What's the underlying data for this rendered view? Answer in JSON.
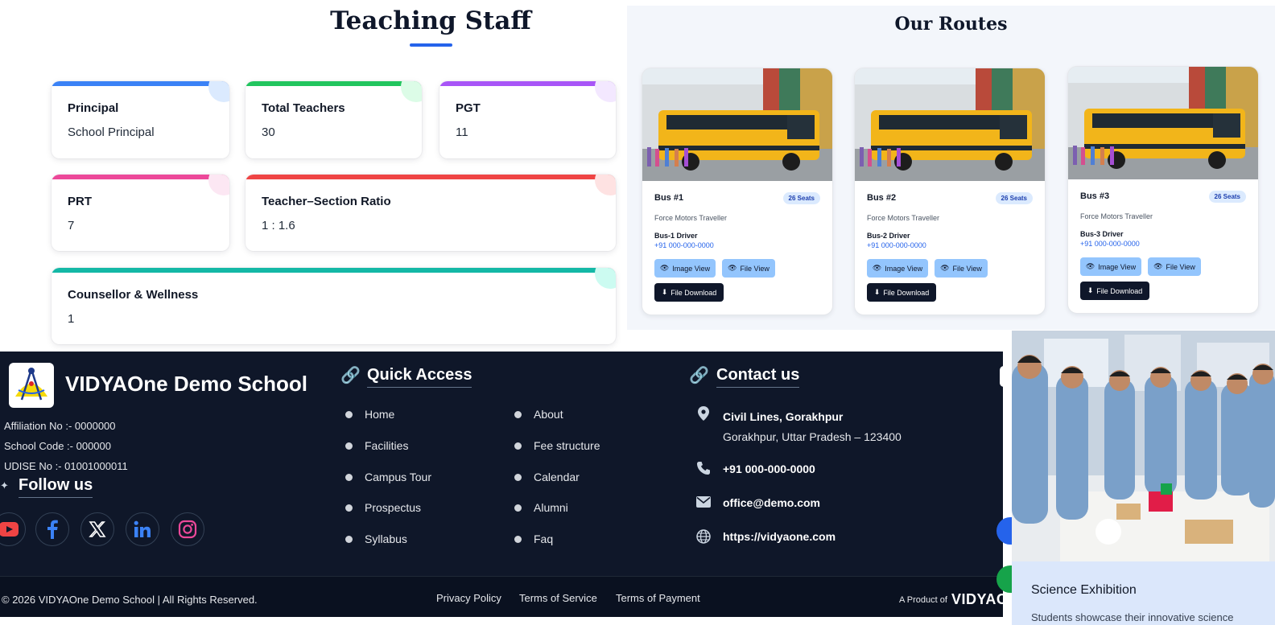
{
  "staff": {
    "title": "Teaching Staff",
    "cards": [
      {
        "label": "Principal",
        "value": "School Principal",
        "color": "#3b82f6"
      },
      {
        "label": "Total Teachers",
        "value": "30",
        "color": "#22c55e"
      },
      {
        "label": "PGT",
        "value": "11",
        "color": "#a855f7"
      },
      {
        "label": "PRT",
        "value": "7",
        "color": "#ec4899"
      },
      {
        "label": "Teacher–Section Ratio",
        "value": "1 : 1.6",
        "color": "#ef4444"
      },
      {
        "label": "Counsellor & Wellness",
        "value": "1",
        "color": "#14b8a6"
      }
    ]
  },
  "routes": {
    "title": "Our Routes",
    "buses": [
      {
        "name": "Bus #1",
        "seats": "26 Seats",
        "model": "Force Motors Traveller",
        "driver": "Bus-1 Driver",
        "phone": "+91 000-000-0000",
        "image_view": "Image View",
        "file_view": "File View",
        "file_download": "File Download"
      },
      {
        "name": "Bus #2",
        "seats": "26 Seats",
        "model": "Force Motors Traveller",
        "driver": "Bus-2 Driver",
        "phone": "+91 000-000-0000",
        "image_view": "Image View",
        "file_view": "File View",
        "file_download": "File Download"
      },
      {
        "name": "Bus #3",
        "seats": "26 Seats",
        "model": "Force Motors Traveller",
        "driver": "Bus-3 Driver",
        "phone": "+91 000-000-0000",
        "image_view": "Image View",
        "file_view": "File View",
        "file_download": "File Download"
      }
    ]
  },
  "footer": {
    "school_name": "VIDYAOne Demo School",
    "affiliation": "Affiliation No :- 0000000",
    "school_code": "School Code :- 000000",
    "udise": "UDISE No :- 01001000011",
    "follow_title": "Follow us",
    "socials": [
      "youtube-icon",
      "facebook-icon",
      "x-icon",
      "linkedin-icon",
      "instagram-icon"
    ],
    "quick_access_title": "Quick Access",
    "quick_links_left": [
      "Home",
      "Facilities",
      "Campus Tour",
      "Prospectus",
      "Syllabus"
    ],
    "quick_links_right": [
      "About",
      "Fee structure",
      "Calendar",
      "Alumni",
      "Faq"
    ],
    "contact_title": "Contact us",
    "address_line1": "Civil Lines, Gorakhpur",
    "address_line2": "Gorakhpur, Uttar Pradesh – 123400",
    "phone": "+91 000-000-0000",
    "email": "office@demo.com",
    "website": "https://vidyaone.com",
    "copyright": "2026 VIDYAOne Demo School | All Rights Reserved.",
    "links": [
      "Privacy Policy",
      "Terms of Service",
      "Terms of Payment"
    ],
    "product_label": "A Product of",
    "product_brand": "VIDYAO"
  },
  "gallery": {
    "title": "Science Exhibition",
    "description": "Students showcase their innovative science"
  }
}
